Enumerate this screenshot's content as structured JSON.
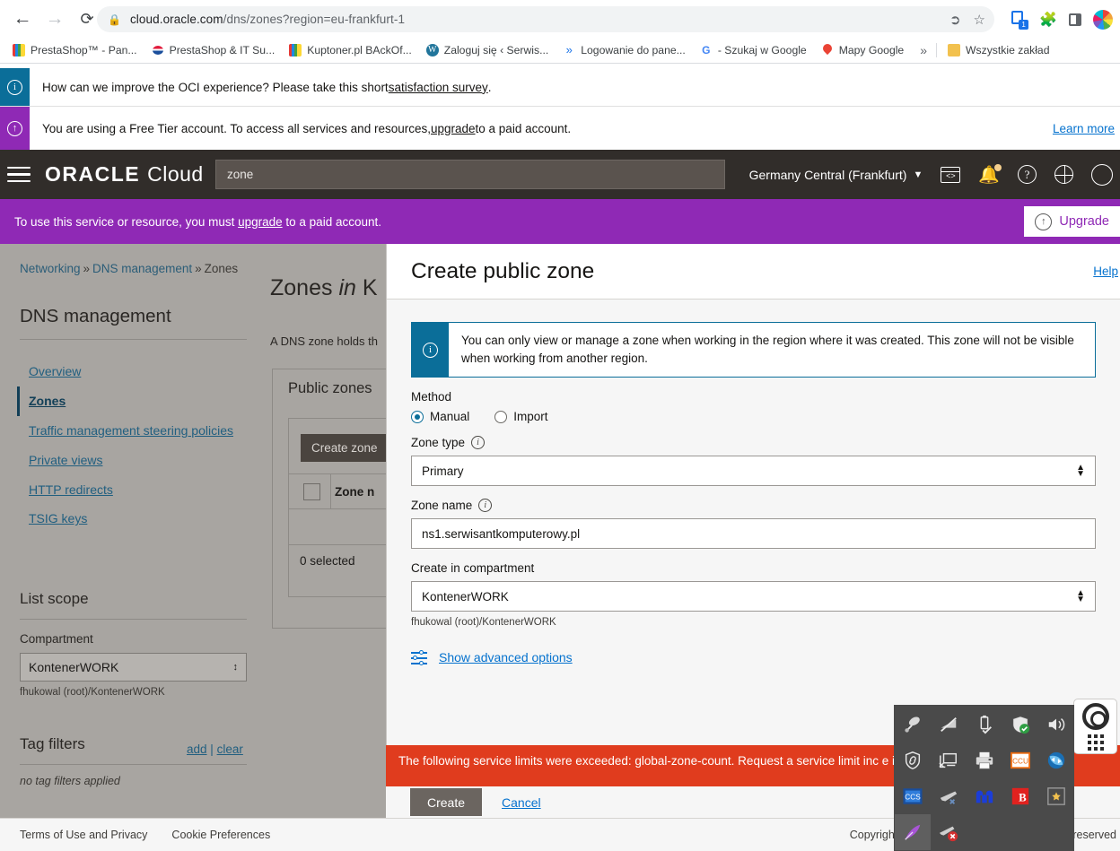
{
  "browser": {
    "url_domain": "cloud.oracle.com",
    "url_path": "/dns/zones?region=eu-frankfurt-1",
    "back_icon": "back-arrow-icon",
    "forward_icon": "forward-arrow-icon",
    "reload_icon": "reload-icon",
    "lock_icon": "lock-icon",
    "share_icon": "share-icon",
    "star_icon": "star-icon",
    "tab_badge_count": "1",
    "bookmarks": [
      {
        "label": "PrestaShop™ - Pan...",
        "icon": "pixel-favicon"
      },
      {
        "label": "PrestaShop & IT Su...",
        "icon": "prestashop-favicon"
      },
      {
        "label": "Kuptoner.pl BAckOf...",
        "icon": "pixel-favicon"
      },
      {
        "label": "Zaloguj się ‹ Serwis...",
        "icon": "wordpress-favicon"
      },
      {
        "label": "Logowanie do pane...",
        "icon": "blue-chevrons-favicon"
      },
      {
        "label": "- Szukaj w Google",
        "icon": "google-favicon"
      },
      {
        "label": "Mapy Google",
        "icon": "map-pin-favicon"
      }
    ],
    "bookmarks_overflow": "»",
    "all_bookmarks_label": "Wszystkie zakład"
  },
  "banners": {
    "survey": {
      "text_before": "How can we improve the OCI experience? Please take this short ",
      "link": "satisfaction survey",
      "text_after": "."
    },
    "free_tier": {
      "text_before": "You are using a Free Tier account. To access all services and resources, ",
      "link": "upgrade",
      "text_after": " to a paid account.",
      "learn_more": "Learn more"
    }
  },
  "header": {
    "brand_oracle": "ORACLE",
    "brand_cloud": "Cloud",
    "search_value": "zone",
    "region": "Germany Central (Frankfurt)",
    "icons": [
      "menu-icon",
      "cloud-shell-icon",
      "notifications-bell-icon",
      "help-icon",
      "region-globe-icon",
      "user-avatar-icon"
    ]
  },
  "upgrade_bar": {
    "text_before": "To use this service or resource, you must ",
    "link": "upgrade",
    "text_after": " to a paid account.",
    "button_label": "Upgrade"
  },
  "breadcrumb": {
    "item1": "Networking",
    "item2": "DNS management",
    "item3": "Zones",
    "separator": "»"
  },
  "sidebar": {
    "title": "DNS management",
    "items": [
      {
        "label": "Overview",
        "active": false
      },
      {
        "label": "Zones",
        "active": true
      },
      {
        "label": "Traffic management steering policies",
        "active": false
      },
      {
        "label": "Private views",
        "active": false
      },
      {
        "label": "HTTP redirects",
        "active": false
      },
      {
        "label": "TSIG keys",
        "active": false
      }
    ],
    "list_scope_title": "List scope",
    "compartment_label": "Compartment",
    "compartment_value": "KontenerWORK",
    "compartment_path": "fhukowal (root)/KontenerWORK",
    "tag_filters_title": "Tag filters",
    "tag_add": "add",
    "tag_sep": "|",
    "tag_clear": "clear",
    "tag_empty": "no tag filters applied"
  },
  "main": {
    "title_prefix": "Zones ",
    "title_italic": "in ",
    "title_suffix": "K",
    "description": "A DNS zone holds th",
    "tab_label": "Public zones",
    "create_zone_button": "Create zone",
    "table_header_zone_name": "Zone n",
    "selected_count": "0 selected"
  },
  "panel": {
    "title": "Create public zone",
    "help_link": "Help",
    "alert": "You can only view or manage a zone when working in the region where it was created. This zone will not be visible when working from another region.",
    "alert_icon": "info-icon",
    "method_label": "Method",
    "method_options": [
      {
        "label": "Manual",
        "selected": true
      },
      {
        "label": "Import",
        "selected": false
      }
    ],
    "zone_type_label": "Zone type",
    "zone_type_value": "Primary",
    "zone_name_label": "Zone name",
    "zone_name_value": "ns1.serwisantkomputerowy.pl",
    "compartment_label": "Create in compartment",
    "compartment_value": "KontenerWORK",
    "compartment_path": "fhukowal (root)/KontenerWORK",
    "advanced_link": "Show advanced options",
    "error_message": "The following service limits were exceeded: global-zone-count. Request a service limit inc                              e in the console.",
    "create_button": "Create",
    "cancel_button": "Cancel"
  },
  "footer": {
    "terms": "Terms of Use and Privacy",
    "cookies": "Cookie Preferences",
    "copyright_left": "Copyright",
    "copyright_right": "nts reserved"
  },
  "fab": {
    "icon": "lifesaver-help-icon",
    "grid_icon": "apps-grid-icon"
  },
  "tray": {
    "icons": [
      "satellite-dish-icon",
      "network-disconnected-icon",
      "usb-safely-remove-icon",
      "security-shield-ok-icon",
      "volume-speaker-icon",
      "shield-link-icon",
      "remote-desktop-disconnected-icon",
      "printer-icon",
      "ccu-orange-icon",
      "teamviewer-icon",
      "ccs-blue-icon",
      "plane-x-icon",
      "malwarebytes-icon",
      "bitdefender-icon",
      "tool-star-icon",
      "purple-feather-icon",
      "plane-cancel-icon"
    ]
  },
  "colors": {
    "oracle_red": "#c74634",
    "header_dark": "#312d2a",
    "purple": "#8f29b5",
    "info_blue": "#0b6e99",
    "link_blue": "#0572ce",
    "error_red": "#e03c1e"
  }
}
